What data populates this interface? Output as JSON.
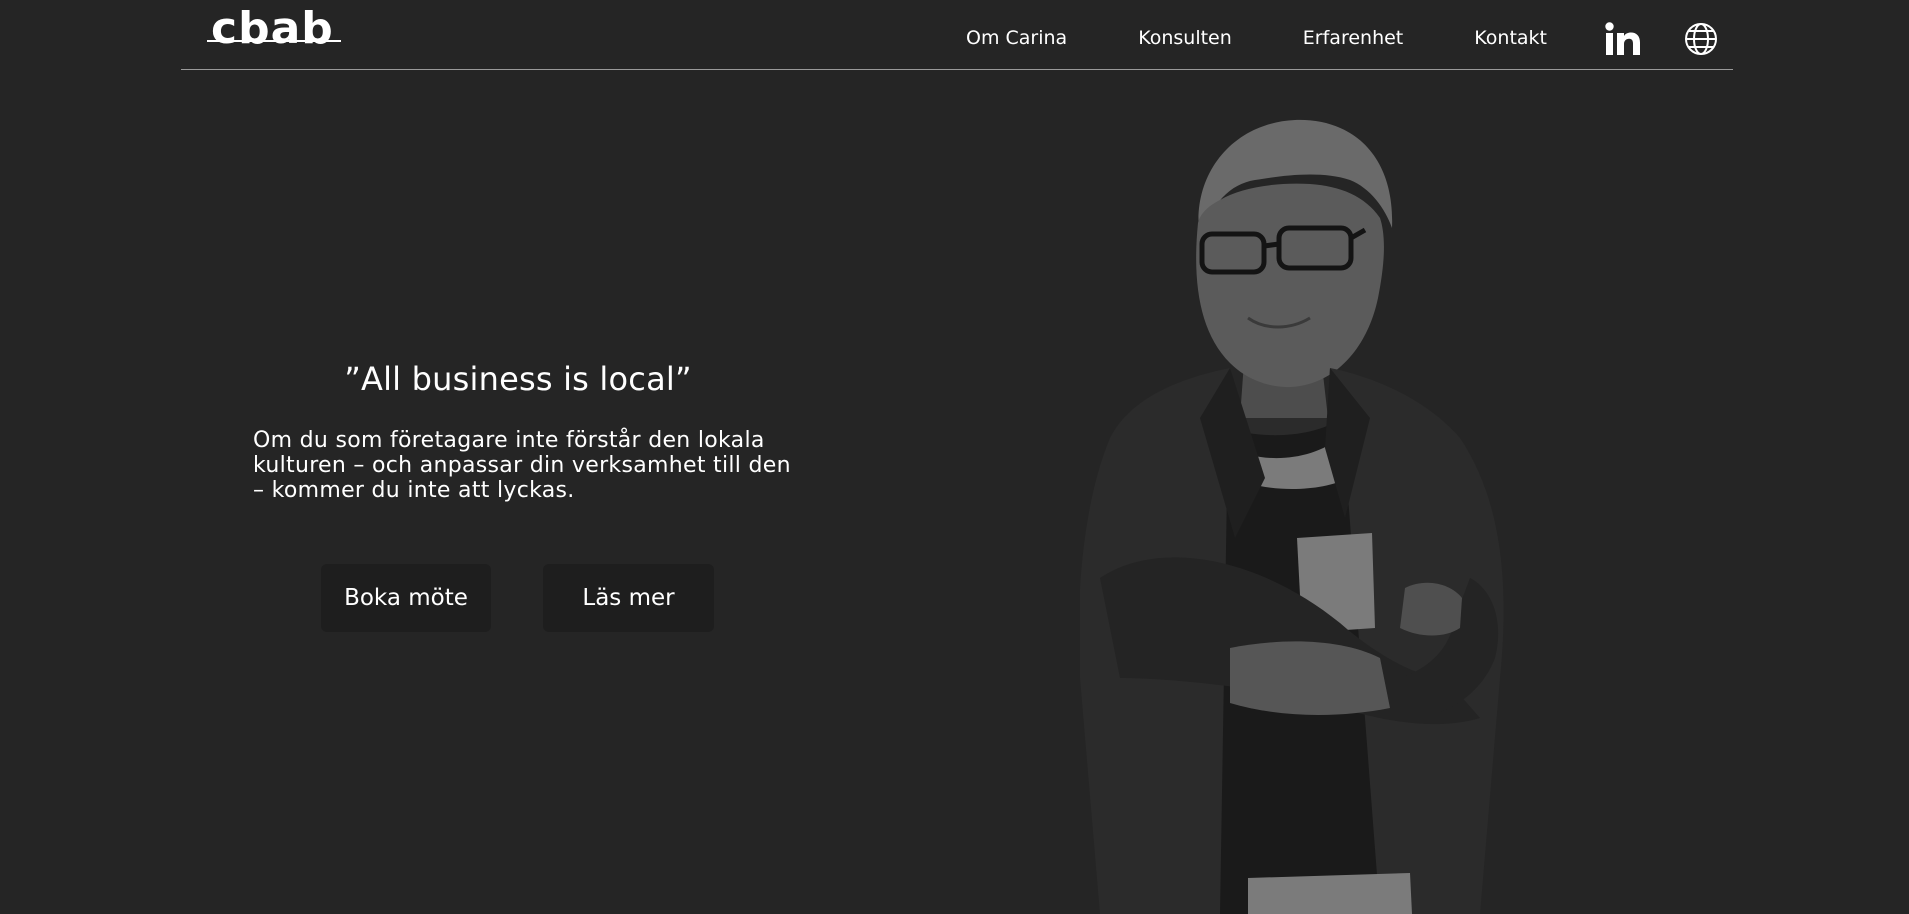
{
  "header": {
    "logo_text": "cbab",
    "nav": [
      {
        "label": "Om Carina"
      },
      {
        "label": "Konsulten"
      },
      {
        "label": "Erfarenhet"
      },
      {
        "label": "Kontakt"
      }
    ],
    "social_icon": "linkedin-icon",
    "language_icon": "globe-icon"
  },
  "hero": {
    "quote": "”All business is local”",
    "lead": "Om du som företagare inte förstår den lokala kulturen – och anpassar din verksamhet till den – kommer du inte att lyckas.",
    "primary_button": "Boka möte",
    "secondary_button": "Läs mer"
  },
  "colors": {
    "background": "#252525",
    "text": "#ffffff",
    "button_bg": "#1e1e1e",
    "divider": "#9a9a9a"
  }
}
